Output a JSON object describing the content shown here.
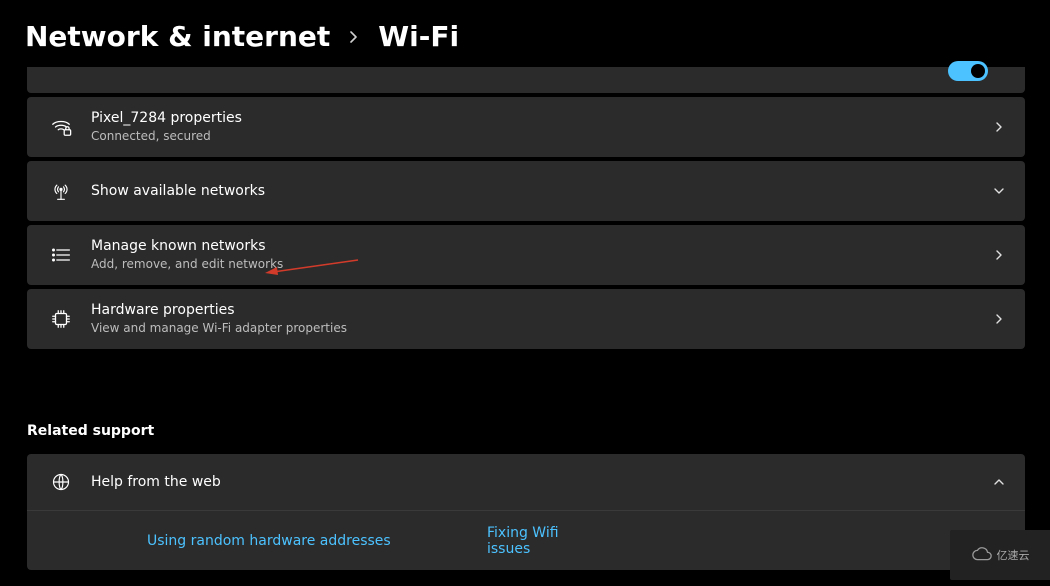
{
  "breadcrumb": {
    "parent": "Network & internet",
    "current": "Wi-Fi"
  },
  "rows": {
    "wifiProps": {
      "title": "Pixel_7284 properties",
      "sub": "Connected, secured"
    },
    "available": {
      "title": "Show available networks"
    },
    "manage": {
      "title": "Manage known networks",
      "sub": "Add, remove, and edit networks"
    },
    "hardware": {
      "title": "Hardware properties",
      "sub": "View and manage Wi-Fi adapter properties"
    }
  },
  "section": {
    "relatedHeading": "Related support"
  },
  "help": {
    "title": "Help from the web"
  },
  "links": {
    "random": "Using random hardware addresses",
    "fix": "Fixing Wifi issues"
  },
  "watermark": "亿速云"
}
